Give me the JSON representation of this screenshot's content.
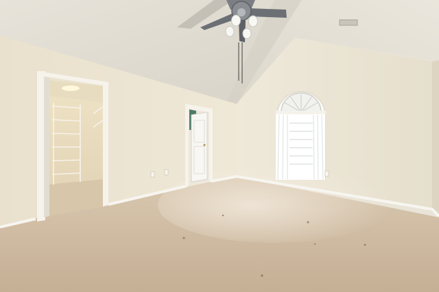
{
  "scene": {
    "description_type": "photo",
    "palette": {
      "ceiling": "#e4e0d6",
      "wall_left": "#ebe4d2",
      "wall_right": "#ece6d6",
      "carpet": "#cdb9a0",
      "trim": "#f2f0ea",
      "fan_metal": "#6f7378",
      "window_light": "#ffffff"
    }
  }
}
